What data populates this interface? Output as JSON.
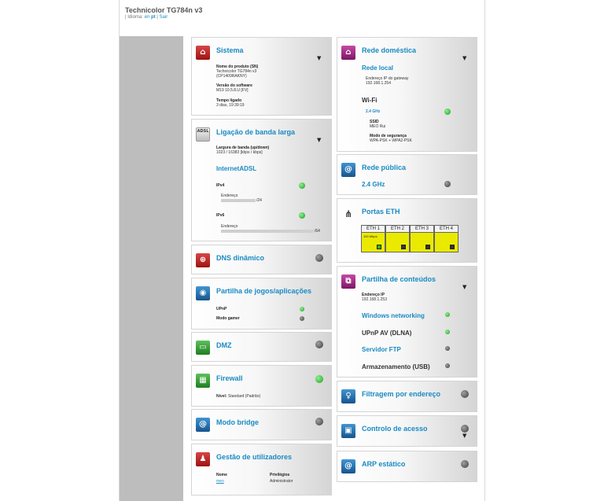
{
  "header": {
    "title": "Technicolor TG784n v3",
    "idioma_label": "| Idioma:",
    "lang_en": "en",
    "lang_pt": "pt",
    "separator": "|",
    "logout": "Sair"
  },
  "sistema": {
    "title": "Sistema",
    "product_label": "Nome do produto (SN)",
    "product_value": "Technicolor TG784n v3",
    "product_serial": "(CP1409RAKNY)",
    "software_label": "Versão do software",
    "software_value": "M19 10.5.8.U [FV]",
    "uptime_label": "Tempo ligado",
    "uptime_value": "3 dias, 19:39:19"
  },
  "banda": {
    "icon_text": "ADSL",
    "title": "Ligação de banda larga",
    "bw_label": "Largura de banda (up/down)",
    "bw_value": "1023 / 16383 [kbps / kbps]",
    "service": "InternetADSL",
    "ipv4": "IPv4",
    "addr_label": "Endereço",
    "ipv4_suffix": "/24",
    "ipv6": "IPv6",
    "ipv6_suffix": "/64"
  },
  "dns": {
    "title": "DNS dinâmico"
  },
  "jogos": {
    "title": "Partilha de jogos/aplicações",
    "upnp": "UPnP",
    "gamer": "Modo gamer"
  },
  "dmz": {
    "title": "DMZ"
  },
  "firewall": {
    "title": "Firewall",
    "level_label": "Nível:",
    "level_value": "Standard (Padrão)"
  },
  "bridge": {
    "title": "Modo bridge"
  },
  "users": {
    "title": "Gestão de utilizadores",
    "col_name": "Nome",
    "col_priv": "Privilégios",
    "user_name": "meo",
    "user_priv": "Administrator"
  },
  "rede_dom": {
    "title": "Rede doméstica",
    "local": "Rede local",
    "gw_label": "Endereço IP do gateway",
    "gw_value": "192.168.1.254",
    "wifi": "Wi-Fi",
    "band": "2.4 GHz",
    "ssid_label": "SSID",
    "ssid_value": "MEO Rui",
    "sec_label": "Modo de segurança",
    "sec_value": "WPA-PSK + WPA2-PSK"
  },
  "rede_pub": {
    "title": "Rede pública",
    "band": "2.4 GHz"
  },
  "eth": {
    "title": "Portas ETH",
    "ports": [
      "ETH 1",
      "ETH 2",
      "ETH 3",
      "ETH 4"
    ],
    "speed": "100 Mbps"
  },
  "conteudos": {
    "title": "Partilha de conteúdos",
    "ip_label": "Endereço IP",
    "ip_value": "192.168.1.253",
    "win": "Windows networking",
    "upnpav": "UPnP AV (DLNA)",
    "ftp": "Servidor FTP",
    "storage": "Armazenamento (USB)"
  },
  "filtro": {
    "title": "Filtragem por endereço"
  },
  "controlo": {
    "title": "Controlo de acesso"
  },
  "arp": {
    "title": "ARP estático"
  }
}
